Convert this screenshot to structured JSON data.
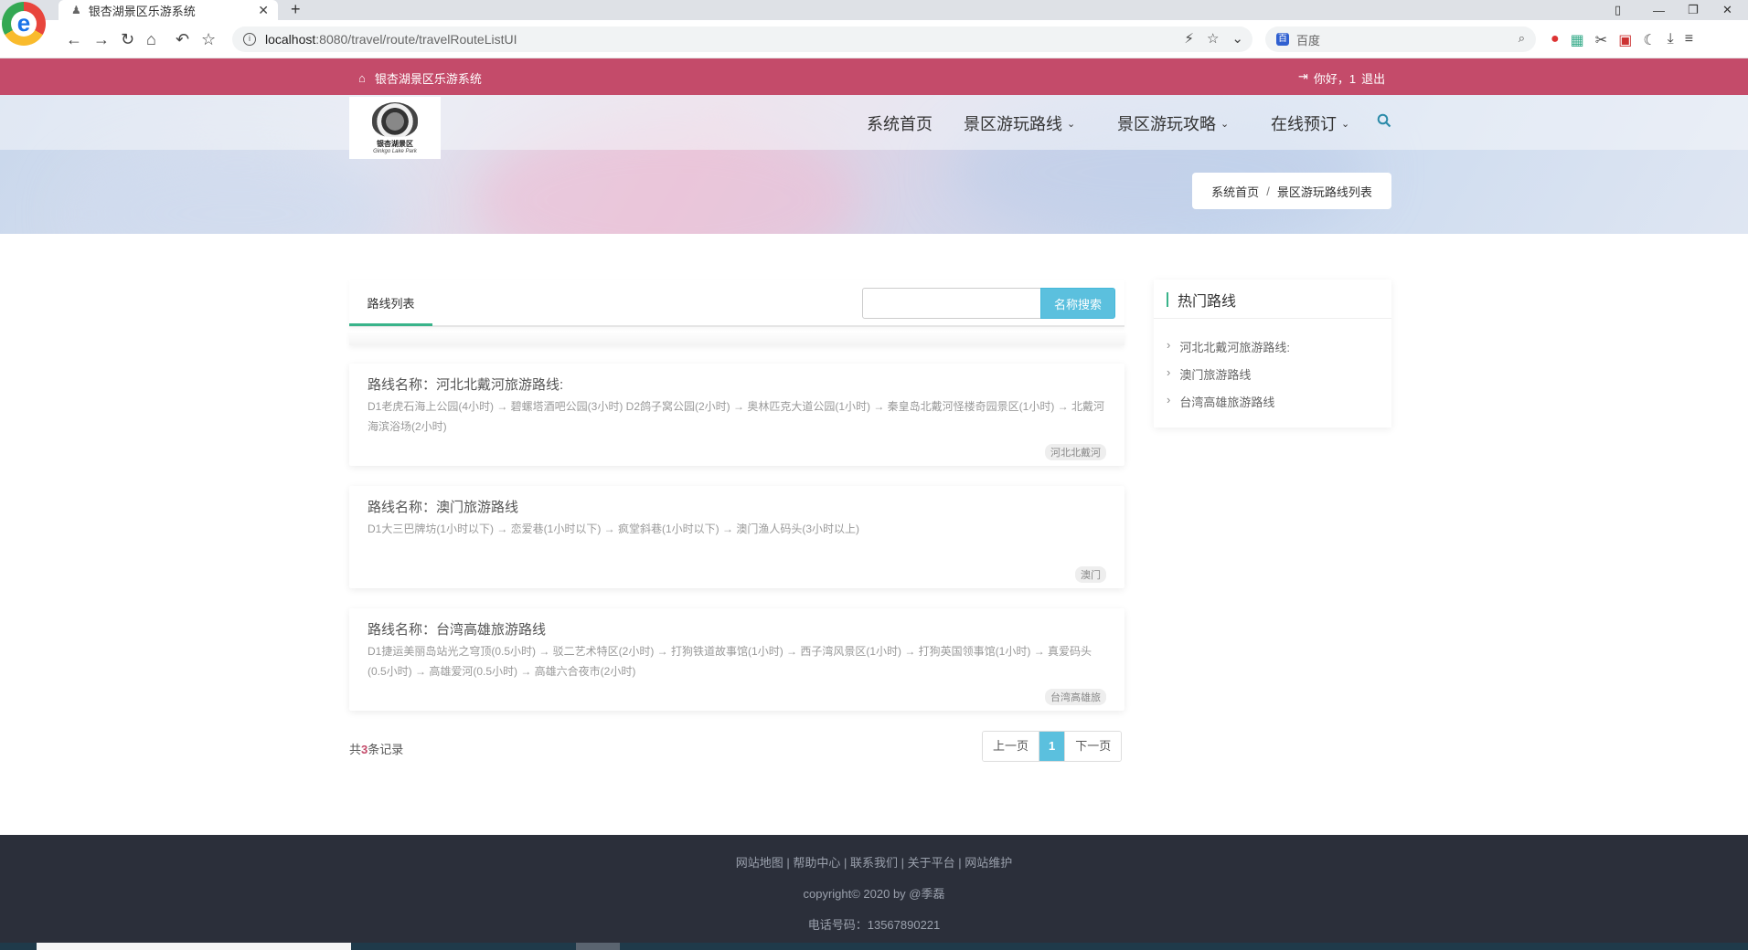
{
  "browser": {
    "tab_title": "银杏湖景区乐游系统",
    "url_host": "localhost",
    "url_path": ":8080/travel/route/travelRouteListUI",
    "search_engine": "百度"
  },
  "topbar": {
    "site_name": "银杏湖景区乐游系统",
    "greeting": "你好，1",
    "logout": "退出"
  },
  "logo": {
    "text": "银杏湖景区",
    "sub": "Ginkgo Lake Park"
  },
  "nav": {
    "items": [
      "系统首页",
      "景区游玩路线",
      "景区游玩攻略",
      "在线预订"
    ]
  },
  "breadcrumb": {
    "home": "系统首页",
    "sep": "/",
    "current": "景区游玩路线列表"
  },
  "list": {
    "tab_label": "路线列表",
    "search_placeholder": "",
    "search_button": "名称搜索",
    "routes": [
      {
        "name": "路线名称：河北北戴河旅游路线:",
        "desc": "D1老虎石海上公园(4小时) → 碧螺塔酒吧公园(3小时) D2鸽子窝公园(2小时) → 奥林匹克大道公园(1小时) → 秦皇岛北戴河怪楼奇园景区(1小时) → 北戴河海滨浴场(2小时)",
        "tag": "河北北戴河"
      },
      {
        "name": "路线名称：澳门旅游路线",
        "desc": "D1大三巴牌坊(1小时以下) → 恋爱巷(1小时以下) → 疯堂斜巷(1小时以下) → 澳门渔人码头(3小时以上)",
        "tag": "澳门"
      },
      {
        "name": "路线名称：台湾高雄旅游路线",
        "desc": "D1捷运美丽岛站光之穹顶(0.5小时) → 驳二艺术特区(2小时) → 打狗铁道故事馆(1小时) → 西子湾风景区(1小时) → 打狗英国领事馆(1小时) → 真爱码头(0.5小时) → 高雄爱河(0.5小时) → 高雄六合夜市(2小时)",
        "tag": "台湾高雄旅"
      }
    ],
    "record_prefix": "共",
    "record_count": "3",
    "record_suffix": "条记录",
    "pager": {
      "prev": "上一页",
      "current": "1",
      "next": "下一页"
    }
  },
  "sidebar": {
    "title": "热门路线",
    "items": [
      "河北北戴河旅游路线:",
      "澳门旅游路线",
      "台湾高雄旅游路线"
    ]
  },
  "footer": {
    "links": "网站地图 | 帮助中心 | 联系我们 | 关于平台 | 网站维护",
    "copyright": "copyright© 2020 by @季磊",
    "phone": "电话号码：13567890221"
  },
  "colors": {
    "topbar": "#c44b6a",
    "accent_green": "#39b38a",
    "button_blue": "#5bc0de",
    "footer": "#2b2f3a"
  }
}
